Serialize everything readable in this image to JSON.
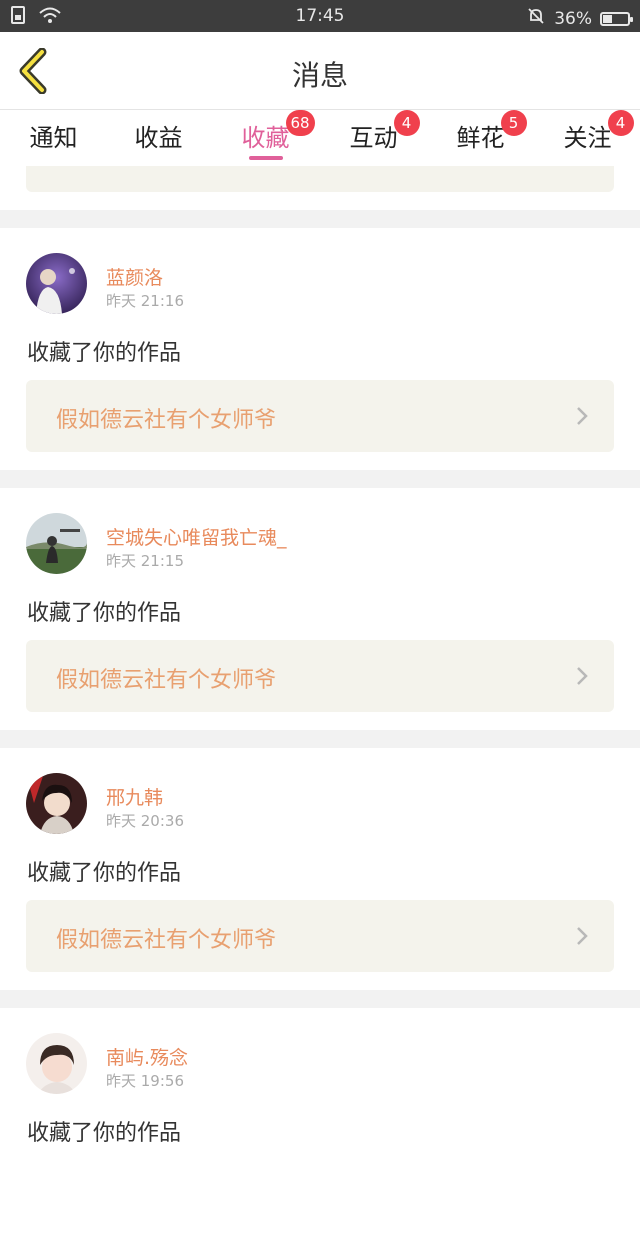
{
  "status_bar": {
    "time": "17:45",
    "battery_text": "36%",
    "battery_level": 0.36
  },
  "header": {
    "title": "消息"
  },
  "tabs": [
    {
      "label": "通知",
      "badge": "",
      "active": false
    },
    {
      "label": "收益",
      "badge": "",
      "active": false
    },
    {
      "label": "收藏",
      "badge": "68",
      "active": true
    },
    {
      "label": "互动",
      "badge": "4",
      "active": false
    },
    {
      "label": "鲜花",
      "badge": "5",
      "active": false
    },
    {
      "label": "关注",
      "badge": "4",
      "active": false
    }
  ],
  "feed": [
    {
      "name": "蓝颜洛",
      "time": "昨天 21:16",
      "action": "收藏了你的作品",
      "work": "假如德云社有个女师爷"
    },
    {
      "name": "空城失心唯留我亡魂_",
      "time": "昨天 21:15",
      "action": "收藏了你的作品",
      "work": "假如德云社有个女师爷"
    },
    {
      "name": "邢九韩",
      "time": "昨天 20:36",
      "action": "收藏了你的作品",
      "work": "假如德云社有个女师爷"
    },
    {
      "name": "南屿.殇念",
      "time": "昨天 19:56",
      "action": "收藏了你的作品",
      "work": ""
    }
  ],
  "colors": {
    "accent": "#e0609a",
    "badge": "#f0404d",
    "name": "#e88a5c",
    "work_title": "#e8a070"
  }
}
